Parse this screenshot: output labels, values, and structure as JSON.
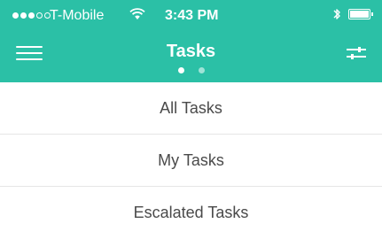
{
  "status_bar": {
    "carrier": "T-Mobile",
    "time": "3:43 PM",
    "signal_filled": 3,
    "signal_empty": 2,
    "icons": [
      "wifi-icon",
      "bluetooth-icon",
      "battery-icon"
    ]
  },
  "nav": {
    "title": "Tasks",
    "left_icon": "hamburger-menu-icon",
    "right_icon": "filter-sliders-icon",
    "pager": {
      "pages": 2,
      "active": 1
    }
  },
  "list": {
    "items": [
      {
        "label": "All Tasks"
      },
      {
        "label": "My Tasks"
      },
      {
        "label": "Escalated Tasks"
      }
    ]
  },
  "colors": {
    "header": "#2bc0a6",
    "text": "#4a4a4a",
    "divider": "#e6e6e6"
  }
}
